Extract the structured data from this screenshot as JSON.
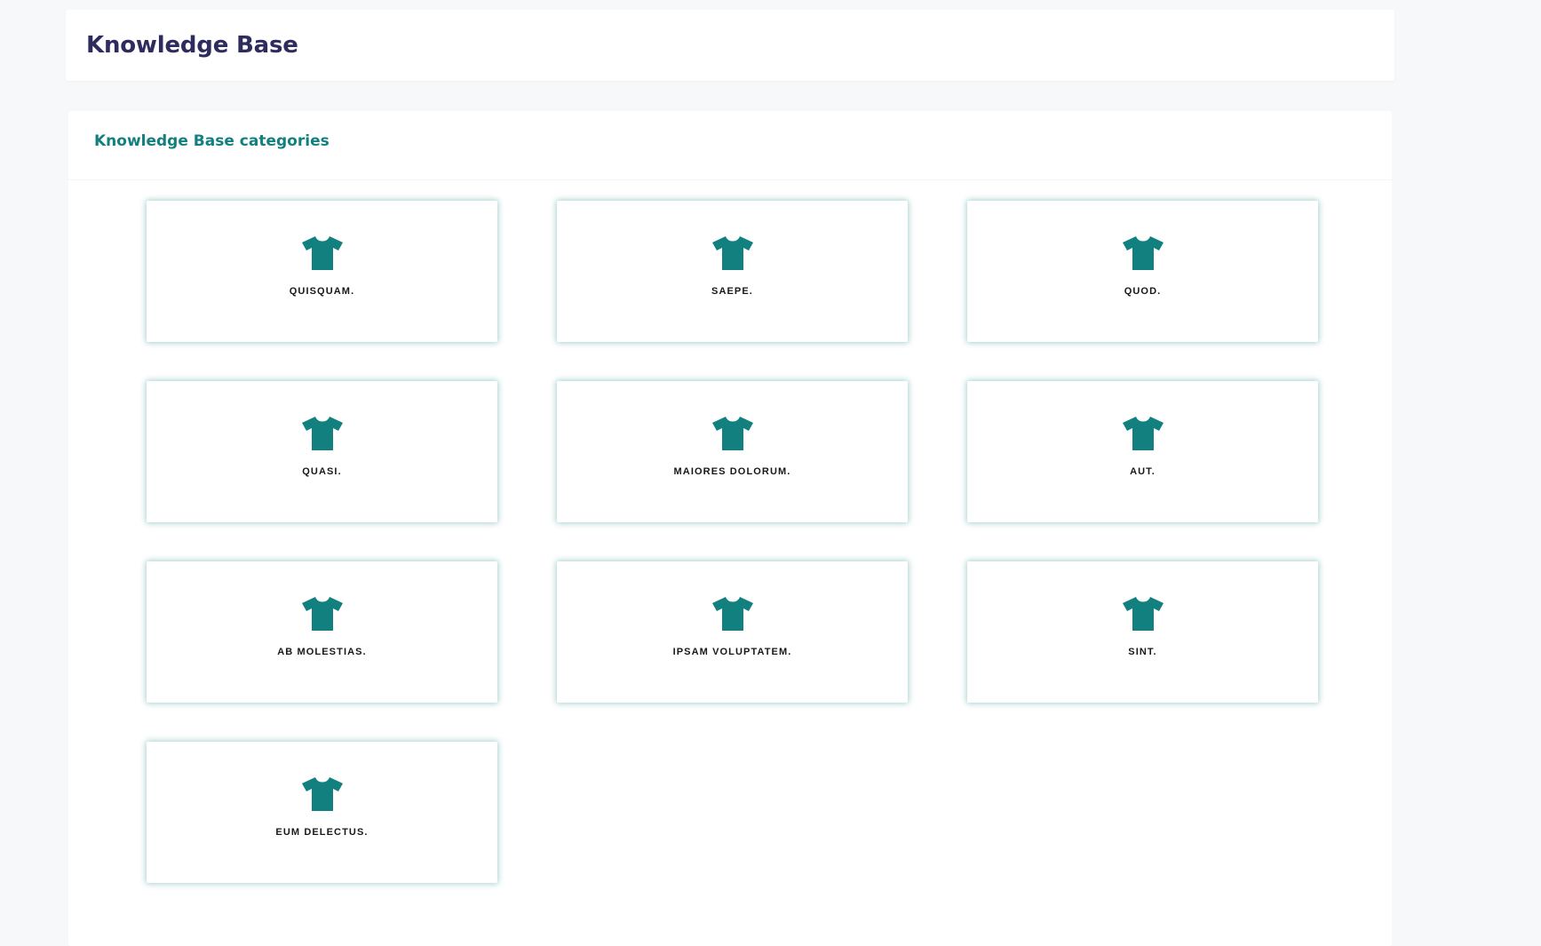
{
  "header": {
    "title": "Knowledge Base"
  },
  "categories_panel": {
    "title": "Knowledge Base categories",
    "icon": "tshirt-icon",
    "accent_color": "#12807e",
    "items": [
      {
        "label": "QUISQUAM."
      },
      {
        "label": "SAEPE."
      },
      {
        "label": "QUOD."
      },
      {
        "label": "QUASI."
      },
      {
        "label": "MAIORES DOLORUM."
      },
      {
        "label": "AUT."
      },
      {
        "label": "AB MOLESTIAS."
      },
      {
        "label": "IPSAM VOLUPTATEM."
      },
      {
        "label": "SINT."
      },
      {
        "label": "EUM DELECTUS."
      }
    ]
  }
}
